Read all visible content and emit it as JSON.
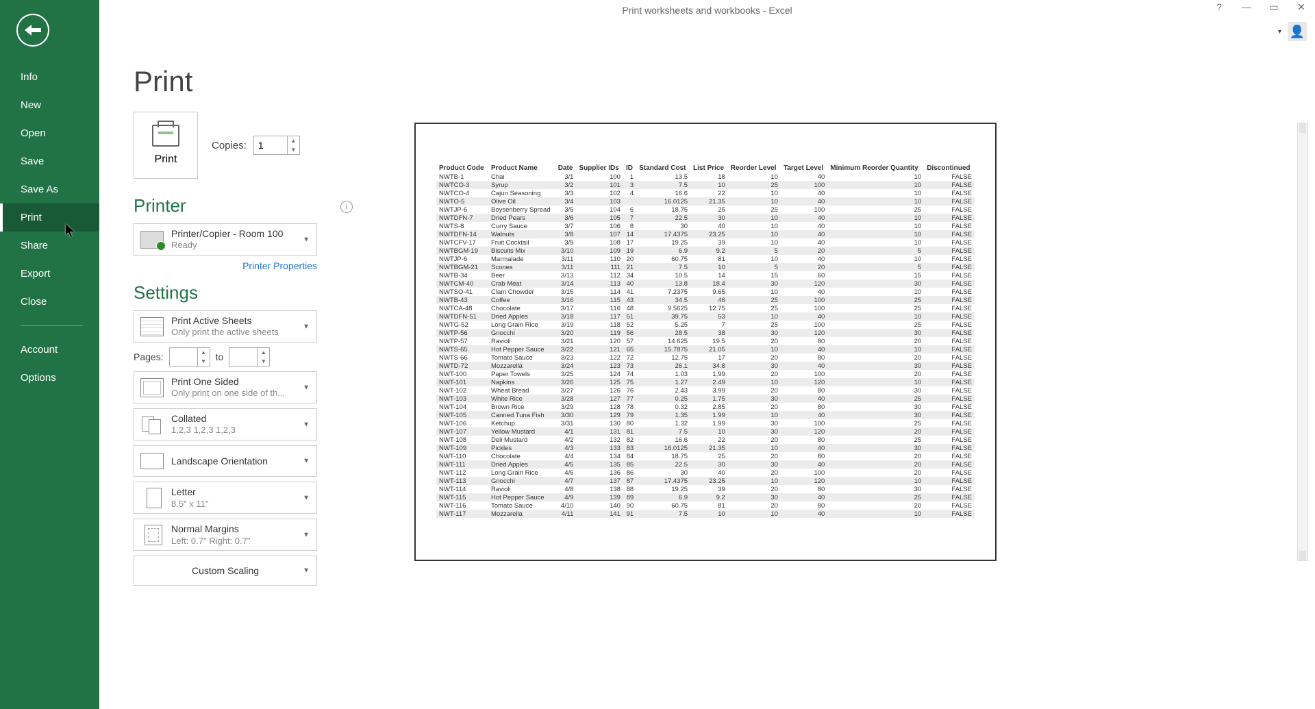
{
  "window": {
    "title": "Print worksheets and workbooks - Excel"
  },
  "sidebar": {
    "items": [
      "Info",
      "New",
      "Open",
      "Save",
      "Save As",
      "Print",
      "Share",
      "Export",
      "Close"
    ],
    "account": "Account",
    "options": "Options",
    "selected_index": 5
  },
  "page": {
    "title": "Print"
  },
  "print_button": {
    "label": "Print"
  },
  "copies": {
    "label": "Copies:",
    "value": "1"
  },
  "printer_section": {
    "title": "Printer",
    "selected": {
      "name": "Printer/Copier - Room 100",
      "status": "Ready"
    },
    "properties_link": "Printer Properties"
  },
  "settings_section": {
    "title": "Settings",
    "pages_label": "Pages:",
    "pages_from": "",
    "pages_to_label": "to",
    "pages_to": "",
    "items": [
      {
        "primary": "Print Active Sheets",
        "secondary": "Only print the active sheets"
      },
      {
        "primary": "Print One Sided",
        "secondary": "Only print on one side of th..."
      },
      {
        "primary": "Collated",
        "secondary": "1,2,3    1,2,3    1,2,3"
      },
      {
        "primary": "Landscape Orientation",
        "secondary": ""
      },
      {
        "primary": "Letter",
        "secondary": "8.5\" x 11\""
      },
      {
        "primary": "Normal Margins",
        "secondary": "Left:  0.7\"    Right:  0.7\""
      },
      {
        "primary": "Custom Scaling",
        "secondary": ""
      }
    ]
  },
  "preview": {
    "headers": [
      "Product Code",
      "Product Name",
      "Date",
      "Supplier IDs",
      "ID",
      "Standard Cost",
      "List Price",
      "Reorder Level",
      "Target Level",
      "Minimum Reorder Quantity",
      "Discontinued"
    ],
    "rows": [
      [
        "NWTB-1",
        "Chai",
        "3/1",
        "100",
        "1",
        "13.5",
        "18",
        "10",
        "40",
        "10",
        "FALSE"
      ],
      [
        "NWTCO-3",
        "Syrup",
        "3/2",
        "101",
        "3",
        "7.5",
        "10",
        "25",
        "100",
        "10",
        "FALSE"
      ],
      [
        "NWTCO-4",
        "Cajun Seasoning",
        "3/3",
        "102",
        "4",
        "16.6",
        "22",
        "10",
        "40",
        "10",
        "FALSE"
      ],
      [
        "NWTO-5",
        "Olive Oil",
        "3/4",
        "103",
        "",
        "16.0125",
        "21.35",
        "10",
        "40",
        "10",
        "FALSE"
      ],
      [
        "NWTJP-6",
        "Boysenberry Spread",
        "3/5",
        "104",
        "6",
        "18.75",
        "25",
        "25",
        "100",
        "25",
        "FALSE"
      ],
      [
        "NWTDFN-7",
        "Dried Pears",
        "3/6",
        "105",
        "7",
        "22.5",
        "30",
        "10",
        "40",
        "10",
        "FALSE"
      ],
      [
        "NWTS-8",
        "Curry Sauce",
        "3/7",
        "106",
        "8",
        "30",
        "40",
        "10",
        "40",
        "10",
        "FALSE"
      ],
      [
        "NWTDFN-14",
        "Walnuts",
        "3/8",
        "107",
        "14",
        "17.4375",
        "23.25",
        "10",
        "40",
        "10",
        "FALSE"
      ],
      [
        "NWTCFV-17",
        "Fruit Cocktail",
        "3/9",
        "108",
        "17",
        "19.25",
        "39",
        "10",
        "40",
        "10",
        "FALSE"
      ],
      [
        "NWTBGM-19",
        "Biscuits Mix",
        "3/10",
        "109",
        "19",
        "6.9",
        "9.2",
        "5",
        "20",
        "5",
        "FALSE"
      ],
      [
        "NWTJP-6",
        "Marmalade",
        "3/11",
        "110",
        "20",
        "60.75",
        "81",
        "10",
        "40",
        "10",
        "FALSE"
      ],
      [
        "NWTBGM-21",
        "Scones",
        "3/11",
        "111",
        "21",
        "7.5",
        "10",
        "5",
        "20",
        "5",
        "FALSE"
      ],
      [
        "NWTB-34",
        "Beer",
        "3/13",
        "112",
        "34",
        "10.5",
        "14",
        "15",
        "60",
        "15",
        "FALSE"
      ],
      [
        "NWTCM-40",
        "Crab Meat",
        "3/14",
        "113",
        "40",
        "13.8",
        "18.4",
        "30",
        "120",
        "30",
        "FALSE"
      ],
      [
        "NWTSO-41",
        "Clam Chowder",
        "3/15",
        "114",
        "41",
        "7.2375",
        "9.65",
        "10",
        "40",
        "10",
        "FALSE"
      ],
      [
        "NWTB-43",
        "Coffee",
        "3/16",
        "115",
        "43",
        "34.5",
        "46",
        "25",
        "100",
        "25",
        "FALSE"
      ],
      [
        "NWTCA-48",
        "Chocolate",
        "3/17",
        "116",
        "48",
        "9.5625",
        "12.75",
        "25",
        "100",
        "25",
        "FALSE"
      ],
      [
        "NWTDFN-51",
        "Dried Apples",
        "3/18",
        "117",
        "51",
        "39.75",
        "53",
        "10",
        "40",
        "10",
        "FALSE"
      ],
      [
        "NWTG-52",
        "Long Grain Rice",
        "3/19",
        "118",
        "52",
        "5.25",
        "7",
        "25",
        "100",
        "25",
        "FALSE"
      ],
      [
        "NWTP-56",
        "Gnocchi",
        "3/20",
        "119",
        "56",
        "28.5",
        "38",
        "30",
        "120",
        "30",
        "FALSE"
      ],
      [
        "NWTP-57",
        "Ravioli",
        "3/21",
        "120",
        "57",
        "14.625",
        "19.5",
        "20",
        "80",
        "20",
        "FALSE"
      ],
      [
        "NWTS-65",
        "Hot Pepper Sauce",
        "3/22",
        "121",
        "65",
        "15.7875",
        "21.05",
        "10",
        "40",
        "10",
        "FALSE"
      ],
      [
        "NWTS-66",
        "Tomato Sauce",
        "3/23",
        "122",
        "72",
        "12.75",
        "17",
        "20",
        "80",
        "20",
        "FALSE"
      ],
      [
        "NWTD-72",
        "Mozzarella",
        "3/24",
        "123",
        "73",
        "26.1",
        "34.8",
        "30",
        "40",
        "30",
        "FALSE"
      ],
      [
        "NWT-100",
        "Paper Towels",
        "3/25",
        "124",
        "74",
        "1.03",
        "1.99",
        "20",
        "100",
        "20",
        "FALSE"
      ],
      [
        "NWT-101",
        "Napkins",
        "3/26",
        "125",
        "75",
        "1.27",
        "2.49",
        "10",
        "120",
        "10",
        "FALSE"
      ],
      [
        "NWT-102",
        "Wheat Bread",
        "3/27",
        "126",
        "76",
        "2.43",
        "3.99",
        "20",
        "80",
        "30",
        "FALSE"
      ],
      [
        "NWT-103",
        "White Rice",
        "3/28",
        "127",
        "77",
        "0.25",
        "1.75",
        "30",
        "40",
        "25",
        "FALSE"
      ],
      [
        "NWT-104",
        "Brown Rice",
        "3/29",
        "128",
        "78",
        "0.32",
        "2.85",
        "20",
        "80",
        "30",
        "FALSE"
      ],
      [
        "NWT-105",
        "Canned Tuna Fish",
        "3/30",
        "129",
        "79",
        "1.35",
        "1.99",
        "10",
        "40",
        "30",
        "FALSE"
      ],
      [
        "NWT-106",
        "Ketchup",
        "3/31",
        "130",
        "80",
        "1.32",
        "1.99",
        "30",
        "100",
        "25",
        "FALSE"
      ],
      [
        "NWT-107",
        "Yellow Mustard",
        "4/1",
        "131",
        "81",
        "7.5",
        "10",
        "30",
        "120",
        "20",
        "FALSE"
      ],
      [
        "NWT-108",
        "Deli Mustard",
        "4/2",
        "132",
        "82",
        "16.6",
        "22",
        "20",
        "80",
        "25",
        "FALSE"
      ],
      [
        "NWT-109",
        "Pickles",
        "4/3",
        "133",
        "83",
        "16.0125",
        "21.35",
        "10",
        "40",
        "30",
        "FALSE"
      ],
      [
        "NWT-110",
        "Chocolate",
        "4/4",
        "134",
        "84",
        "18.75",
        "25",
        "20",
        "80",
        "20",
        "FALSE"
      ],
      [
        "NWT-111",
        "Dried Apples",
        "4/5",
        "135",
        "85",
        "22.5",
        "30",
        "30",
        "40",
        "20",
        "FALSE"
      ],
      [
        "NWT-112",
        "Long Grain Rice",
        "4/6",
        "136",
        "86",
        "30",
        "40",
        "20",
        "100",
        "20",
        "FALSE"
      ],
      [
        "NWT-113",
        "Gnocchi",
        "4/7",
        "137",
        "87",
        "17.4375",
        "23.25",
        "10",
        "120",
        "10",
        "FALSE"
      ],
      [
        "NWT-114",
        "Ravioli",
        "4/8",
        "138",
        "88",
        "19.25",
        "39",
        "20",
        "80",
        "30",
        "FALSE"
      ],
      [
        "NWT-115",
        "Hot Pepper Sauce",
        "4/9",
        "139",
        "89",
        "6.9",
        "9.2",
        "30",
        "40",
        "25",
        "FALSE"
      ],
      [
        "NWT-116",
        "Tomato Sauce",
        "4/10",
        "140",
        "90",
        "60.75",
        "81",
        "20",
        "80",
        "20",
        "FALSE"
      ],
      [
        "NWT-117",
        "Mozzarella",
        "4/11",
        "141",
        "91",
        "7.5",
        "10",
        "10",
        "40",
        "10",
        "FALSE"
      ]
    ]
  }
}
